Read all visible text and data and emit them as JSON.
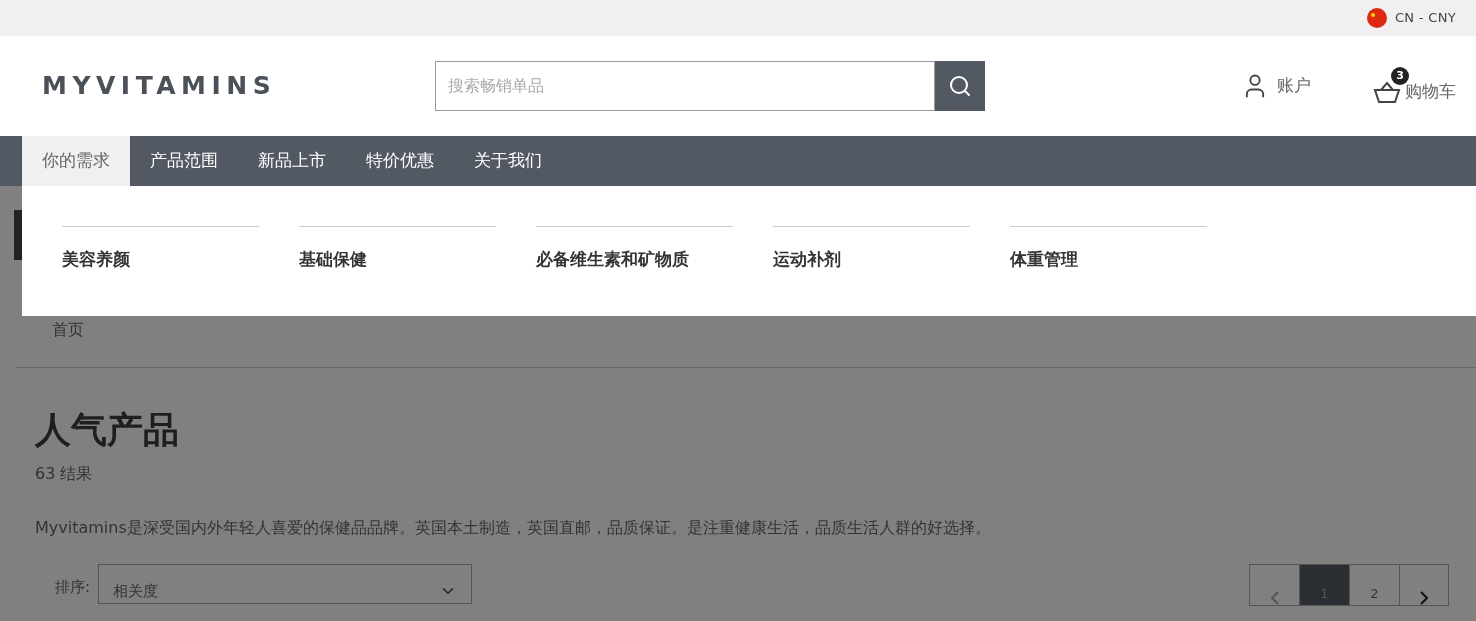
{
  "top_bar": {
    "region": "CN - CNY"
  },
  "header": {
    "logo": "MYVITAMINS",
    "search": {
      "placeholder": "搜索畅销单品"
    },
    "account": "账户",
    "cart": {
      "label": "购物车",
      "count": "3"
    }
  },
  "nav": {
    "tabs": [
      {
        "label": "你的需求",
        "selected": true
      },
      {
        "label": "产品范围",
        "selected": false
      },
      {
        "label": "新品上市",
        "selected": false
      },
      {
        "label": "特价优惠",
        "selected": false
      },
      {
        "label": "关于我们",
        "selected": false
      }
    ]
  },
  "dropdown": {
    "categories": [
      "美容养颜",
      "基础保健",
      "必备维生素和矿物质",
      "运动补剂",
      "体重管理"
    ]
  },
  "page": {
    "breadcrumb": "首页",
    "title": "人气产品",
    "results": "63 结果",
    "description": "Myvitamins是深受国内外年轻人喜爱的保健品品牌。英国本土制造，英国直邮，品质保证。是注重健康生活，品质生活人群的好选择。",
    "sort": {
      "label": "排序:",
      "value": "相关度"
    },
    "pagination": [
      {
        "label": "1",
        "selected": true
      },
      {
        "label": "2",
        "selected": false
      }
    ]
  }
}
